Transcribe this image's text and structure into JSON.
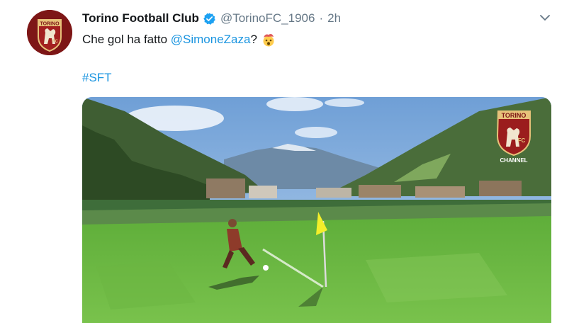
{
  "tweet": {
    "display_name": "Torino Football Club",
    "handle": "@TorinoFC_1906",
    "separator": "·",
    "time": "2h",
    "text_prefix": "Che gol ha fatto ",
    "mention": "@SimoneZaza",
    "text_suffix": "?",
    "emoji_icon": "exploding-head-emoji",
    "hashtag": "#SFT",
    "verified_icon": "verified-badge-icon",
    "menu_icon": "chevron-down-icon"
  },
  "avatar": {
    "logo_text_top": "TORINO",
    "logo_text_fc": "FC"
  },
  "media": {
    "watermark_text_top": "TORINO",
    "watermark_text_fc": "FC",
    "watermark_caption": "CHANNEL"
  },
  "colors": {
    "link": "#1b95e0",
    "muted": "#657786",
    "brand": "#8b1a1a"
  }
}
